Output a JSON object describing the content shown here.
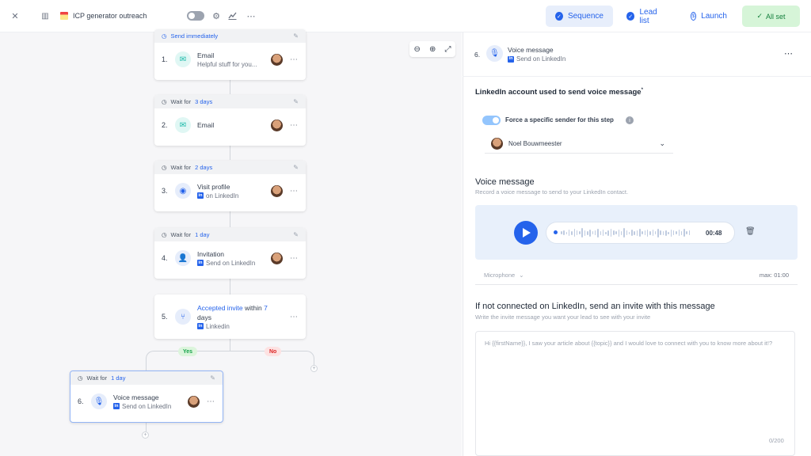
{
  "header": {
    "doc_title": "ICP generator outreach",
    "nav": [
      {
        "label": "Sequence",
        "icon": "check-circle-icon"
      },
      {
        "label": "Lead list",
        "icon": "check-circle-icon"
      },
      {
        "label": "Launch",
        "icon": "dollar-circle-icon"
      }
    ],
    "status": "All set"
  },
  "canvas": {
    "steps": [
      {
        "num": "1.",
        "head_prefix": "Send immediately",
        "head_value": "",
        "title": "Email",
        "subtitle": "Helpful stuff for you...",
        "icon": "email-icon"
      },
      {
        "num": "2.",
        "head_prefix": "Wait for",
        "head_value": "3 days",
        "title": "Email",
        "subtitle": "",
        "icon": "email-icon"
      },
      {
        "num": "3.",
        "head_prefix": "Wait for",
        "head_value": "2 days",
        "title": "Visit profile",
        "subtitle": "on LinkedIn",
        "icon": "eye-icon"
      },
      {
        "num": "4.",
        "head_prefix": "Wait for",
        "head_value": "1 day",
        "title": "Invitation",
        "subtitle": "Send on LinkedIn",
        "icon": "user-plus-icon"
      },
      {
        "num": "6.",
        "head_prefix": "Wait for",
        "head_value": "1 day",
        "title": "Voice message",
        "subtitle": "Send on LinkedIn",
        "icon": "mic-icon"
      }
    ],
    "condition": {
      "num": "5.",
      "link": "Accepted invite",
      "within": "within",
      "days_num": "7",
      "days_word": "days",
      "sub": "Linkedin"
    },
    "yes": "Yes",
    "no": "No"
  },
  "panel": {
    "step_num": "6.",
    "step_title": "Voice message",
    "step_sub": "Send on LinkedIn",
    "account_label": "LinkedIn account used to send voice message",
    "required_mark": "*",
    "force_label": "Force a specific sender for this step",
    "sender": "Noel Bouwmeester",
    "voice_title": "Voice message",
    "voice_desc": "Record a voice message to send to your LinkedIn contact.",
    "duration": "00:48",
    "mic_label": "Microphone",
    "max_label": "max: 01:00",
    "invite_title": "If not connected on LinkedIn, send an invite with this message",
    "invite_desc": "Write the invite message you want your lead to see with your invite",
    "invite_placeholder": "Hi {{firstName}}, I saw your article about {{topic}} and I would love to connect with you to know more about it!?",
    "counter": "0/200"
  },
  "colors": {
    "accent": "#2563eb",
    "success_bg": "#d6f5d8",
    "canvas_bg": "#f6f6f8"
  }
}
